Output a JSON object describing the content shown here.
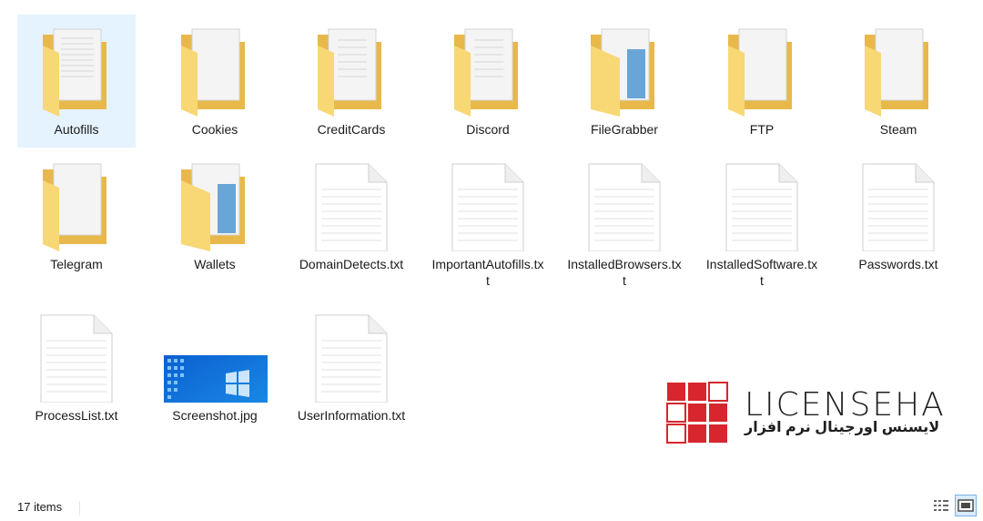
{
  "items": [
    {
      "label": "Autofills",
      "type": "folder",
      "selected": true
    },
    {
      "label": "Cookies",
      "type": "folder"
    },
    {
      "label": "CreditCards",
      "type": "folder"
    },
    {
      "label": "Discord",
      "type": "folder"
    },
    {
      "label": "FileGrabber",
      "type": "folder-image"
    },
    {
      "label": "FTP",
      "type": "folder"
    },
    {
      "label": "Steam",
      "type": "folder"
    },
    {
      "label": "Telegram",
      "type": "folder"
    },
    {
      "label": "Wallets",
      "type": "folder-image"
    },
    {
      "label": "DomainDetects.txt",
      "type": "text"
    },
    {
      "label": "ImportantAutofills.txt",
      "type": "text"
    },
    {
      "label": "InstalledBrowsers.txt",
      "type": "text"
    },
    {
      "label": "InstalledSoftware.txt",
      "type": "text"
    },
    {
      "label": "Passwords.txt",
      "type": "text"
    },
    {
      "label": "ProcessList.txt",
      "type": "text"
    },
    {
      "label": "Screenshot.jpg",
      "type": "image"
    },
    {
      "label": "UserInformation.txt",
      "type": "text"
    }
  ],
  "status": {
    "count": "17 items"
  },
  "watermark": {
    "brand": "LICENSEHA",
    "subtitle": "لایسنس اورجینال نرم افزار"
  },
  "colors": {
    "folder": "#f8d775",
    "folder_dark": "#e8b94a",
    "selection": "#e5f3ff",
    "logo_red": "#d7262d"
  }
}
